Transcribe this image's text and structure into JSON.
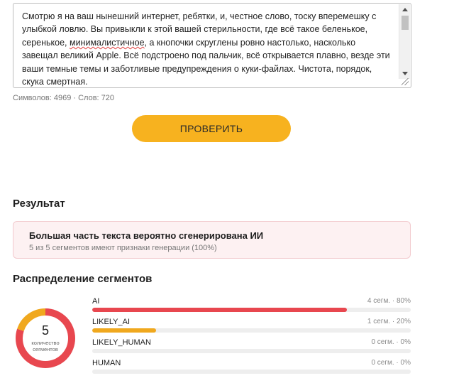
{
  "editor": {
    "text_before": "Смотрю я на ваш нынешний интернет, ребятки, и, честное слово, тоску вперемешку с улыбкой ловлю. Вы привыкли к этой вашей стерильности, где всё такое беленькое, серенькое, ",
    "text_underlined": "минималистичное",
    "text_after": ", а кнопочки скруглены ровно настолько, насколько завещал великий Apple. Всё подстроено под пальчик, всё открывается плавно, везде эти ваши темные темы и заботливые предупреждения о куки-файлах. Чистота, порядок, скука смертная."
  },
  "stats": {
    "text": "Символов: 4969 · Слов: 720"
  },
  "check_button": {
    "label": "ПРОВЕРИТЬ"
  },
  "result": {
    "title": "Результат",
    "headline": "Большая часть текста вероятно сгенерирована ИИ",
    "sub": "5 из 5 сегментов имеют признаки генерации (100%)"
  },
  "distribution": {
    "title": "Распределение сегментов",
    "total": "5",
    "total_label_line1": "количество",
    "total_label_line2": "сегментов",
    "segments": [
      {
        "label": "AI",
        "count_text": "4 сегм. · 80%",
        "fraction": 0.8,
        "color": "#e8474f"
      },
      {
        "label": "LIKELY_AI",
        "count_text": "1 сегм. · 20%",
        "fraction": 0.2,
        "color": "#f0a81e"
      },
      {
        "label": "LIKELY_HUMAN",
        "count_text": "0 сегм. · 0%",
        "fraction": 0.0,
        "color": "#7cc57a"
      },
      {
        "label": "HUMAN",
        "count_text": "0 сегм. · 0%",
        "fraction": 0.0,
        "color": "#3fa34d"
      }
    ]
  },
  "colors": {
    "accent_button": "#f7b21f",
    "result_box_bg": "#fdf1f2",
    "result_box_border": "#f2c9cd"
  }
}
